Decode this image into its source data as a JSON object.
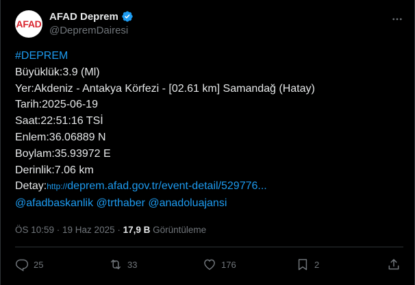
{
  "author": {
    "avatar_text": "AFAD",
    "display_name": "AFAD Deprem",
    "handle": "@DepremDairesi"
  },
  "tweet": {
    "hashtag": "#DEPREM",
    "magnitude": "Büyüklük:3.9 (Ml)",
    "location": "Yer:Akdeniz - Antakya Körfezi - [02.61 km] Samandağ (Hatay)",
    "date": "Tarih:2025-06-19",
    "time": "Saat:22:51:16 TSİ",
    "latitude": "Enlem:36.06889 N",
    "longitude": "Boylam:35.93972 E",
    "depth": "Derinlik:7.06 km",
    "detail_label": "Detay:",
    "detail_url_prefix": "http://",
    "detail_url": "deprem.afad.gov.tr/event-detail/529776...",
    "mentions": [
      "@afadbaskanlik",
      "@trthaber",
      "@anadoluajansi"
    ]
  },
  "meta": {
    "timestamp": "ÖS 10:59 · 19 Haz 2025 · ",
    "views_count": "17,9 B",
    "views_label": " Görüntüleme"
  },
  "actions": {
    "replies": "25",
    "retweets": "33",
    "likes": "176",
    "bookmarks": "2"
  },
  "colors": {
    "background": "#000000",
    "text": "#e7e9ea",
    "muted": "#71767b",
    "link": "#1d9bf0",
    "verified": "#1d9bf0"
  }
}
